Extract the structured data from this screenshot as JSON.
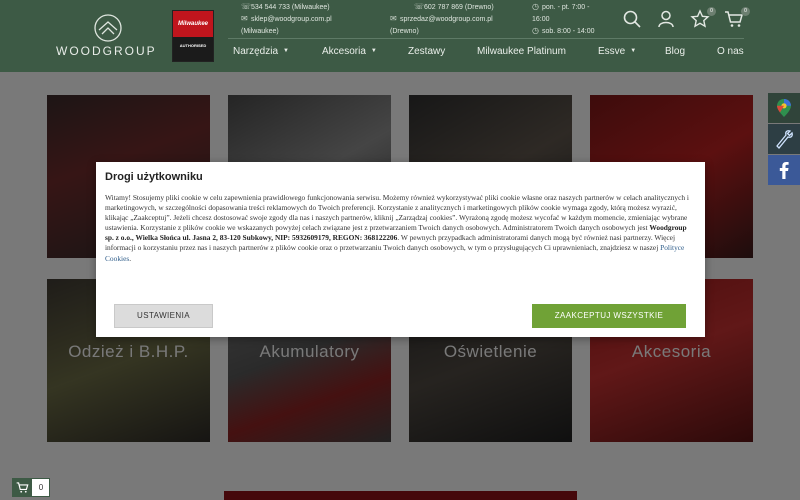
{
  "header": {
    "logo_text": "WOODGROUP",
    "milwaukee_logo": "Milwaukee",
    "milwaukee_badge": "AUTHORISED",
    "contacts": {
      "phone1": "534 544 733 (Milwaukee)",
      "email1": "sklep@woodgroup.com.pl",
      "email1_note": "(Milwaukee)",
      "phone2": "602 787 869 (Drewno)",
      "email2": "sprzedaz@woodgroup.com.pl",
      "email2_note": "(Drewno)",
      "hours1": "pon. - pt. 7:00 - 16:00",
      "hours2": "sob. 8:00 - 14:00"
    },
    "wishlist_count": "0",
    "cart_count": "0"
  },
  "nav": {
    "items": [
      "Narzędzia",
      "Akcesoria",
      "Zestawy",
      "Milwaukee Platinum",
      "Essve",
      "Blog",
      "O nas"
    ]
  },
  "tiles": [
    {
      "label": ""
    },
    {
      "label": ""
    },
    {
      "label": ""
    },
    {
      "label": ""
    },
    {
      "label": "Odzież i B.H.P."
    },
    {
      "label": "Akumulatory"
    },
    {
      "label": "Oświetlenie"
    },
    {
      "label": "Akcesoria"
    }
  ],
  "cookie": {
    "title": "Drogi użytkowniku",
    "body_1": "Witamy! Stosujemy pliki cookie w celu zapewnienia prawidłowego funkcjonowania serwisu. Możemy również wykorzystywać pliki cookie własne oraz naszych partnerów w celach analitycznych i marketingowych, w szczególności dopasowania treści reklamowych do Twoich preferencji. Korzystanie z analitycznych i marketingowych plików cookie wymaga zgody, którą możesz wyrazić, klikając „Zaakceptuj”. Jeżeli chcesz dostosować swoje zgody dla nas i naszych partnerów, kliknij „Zarządzaj cookies”. Wyrażoną zgodę możesz wycofać w każdym momencie, zmieniając wybrane ustawienia. Korzystanie z plików cookie we wskazanych powyżej celach związane jest z przetwarzaniem Twoich danych osobowych. Administratorem Twoich danych osobowych jest ",
    "body_bold": "Woodgroup sp. z o.o., Wielka Słońca ul. Jasna 2, 83-120 Subkowy, NIP: 5932609179, REGON: 368122206",
    "body_2": ". W pewnych przypadkach administratorami danych mogą być również nasi partnerzy. Więcej informacji o korzystaniu przez nas i naszych partnerów z plików cookie oraz o przetwarzaniu Twoich danych osobowych, w tym o przysługujących Ci uprawnieniach, znajdziesz w naszej ",
    "policy_link": "Polityce Cookies",
    "body_end": ".",
    "settings_label": "USTAWIENIA",
    "accept_label": "ZAAKCEPTUJ WSZYSTKIE"
  },
  "floating_cart": {
    "count": "0"
  },
  "colors": {
    "header_bg": "#3d5a45",
    "accept_green": "#70a236",
    "milwaukee_red": "#c0151d"
  }
}
